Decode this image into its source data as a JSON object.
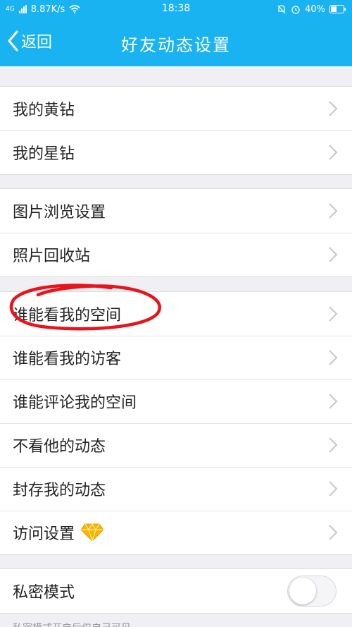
{
  "status": {
    "network": "4G",
    "speed": "8.87K/s",
    "time": "18:38",
    "battery": "40%"
  },
  "nav": {
    "back_label": "返回",
    "title": "好友动态设置"
  },
  "groups": [
    {
      "items": [
        {
          "label": "我的黄钻"
        },
        {
          "label": "我的星钻"
        }
      ]
    },
    {
      "items": [
        {
          "label": "图片浏览设置"
        },
        {
          "label": "照片回收站"
        }
      ]
    },
    {
      "items": [
        {
          "label": "谁能看我的空间"
        },
        {
          "label": "谁能看我的访客"
        },
        {
          "label": "谁能评论我的空间"
        },
        {
          "label": "不看他的动态"
        },
        {
          "label": "封存我的动态"
        },
        {
          "label": "访问设置"
        }
      ]
    },
    {
      "items": [
        {
          "label": "私密模式"
        }
      ]
    }
  ],
  "colors": {
    "header": "#19b3f1",
    "annotation": "#e8141b",
    "diamond": "#f7b500"
  },
  "icons": {
    "back": "chevron-left-icon",
    "row": "chevron-right-icon",
    "vip": "diamond-icon"
  },
  "footer_text": "私密模式开启后仅自己可见"
}
